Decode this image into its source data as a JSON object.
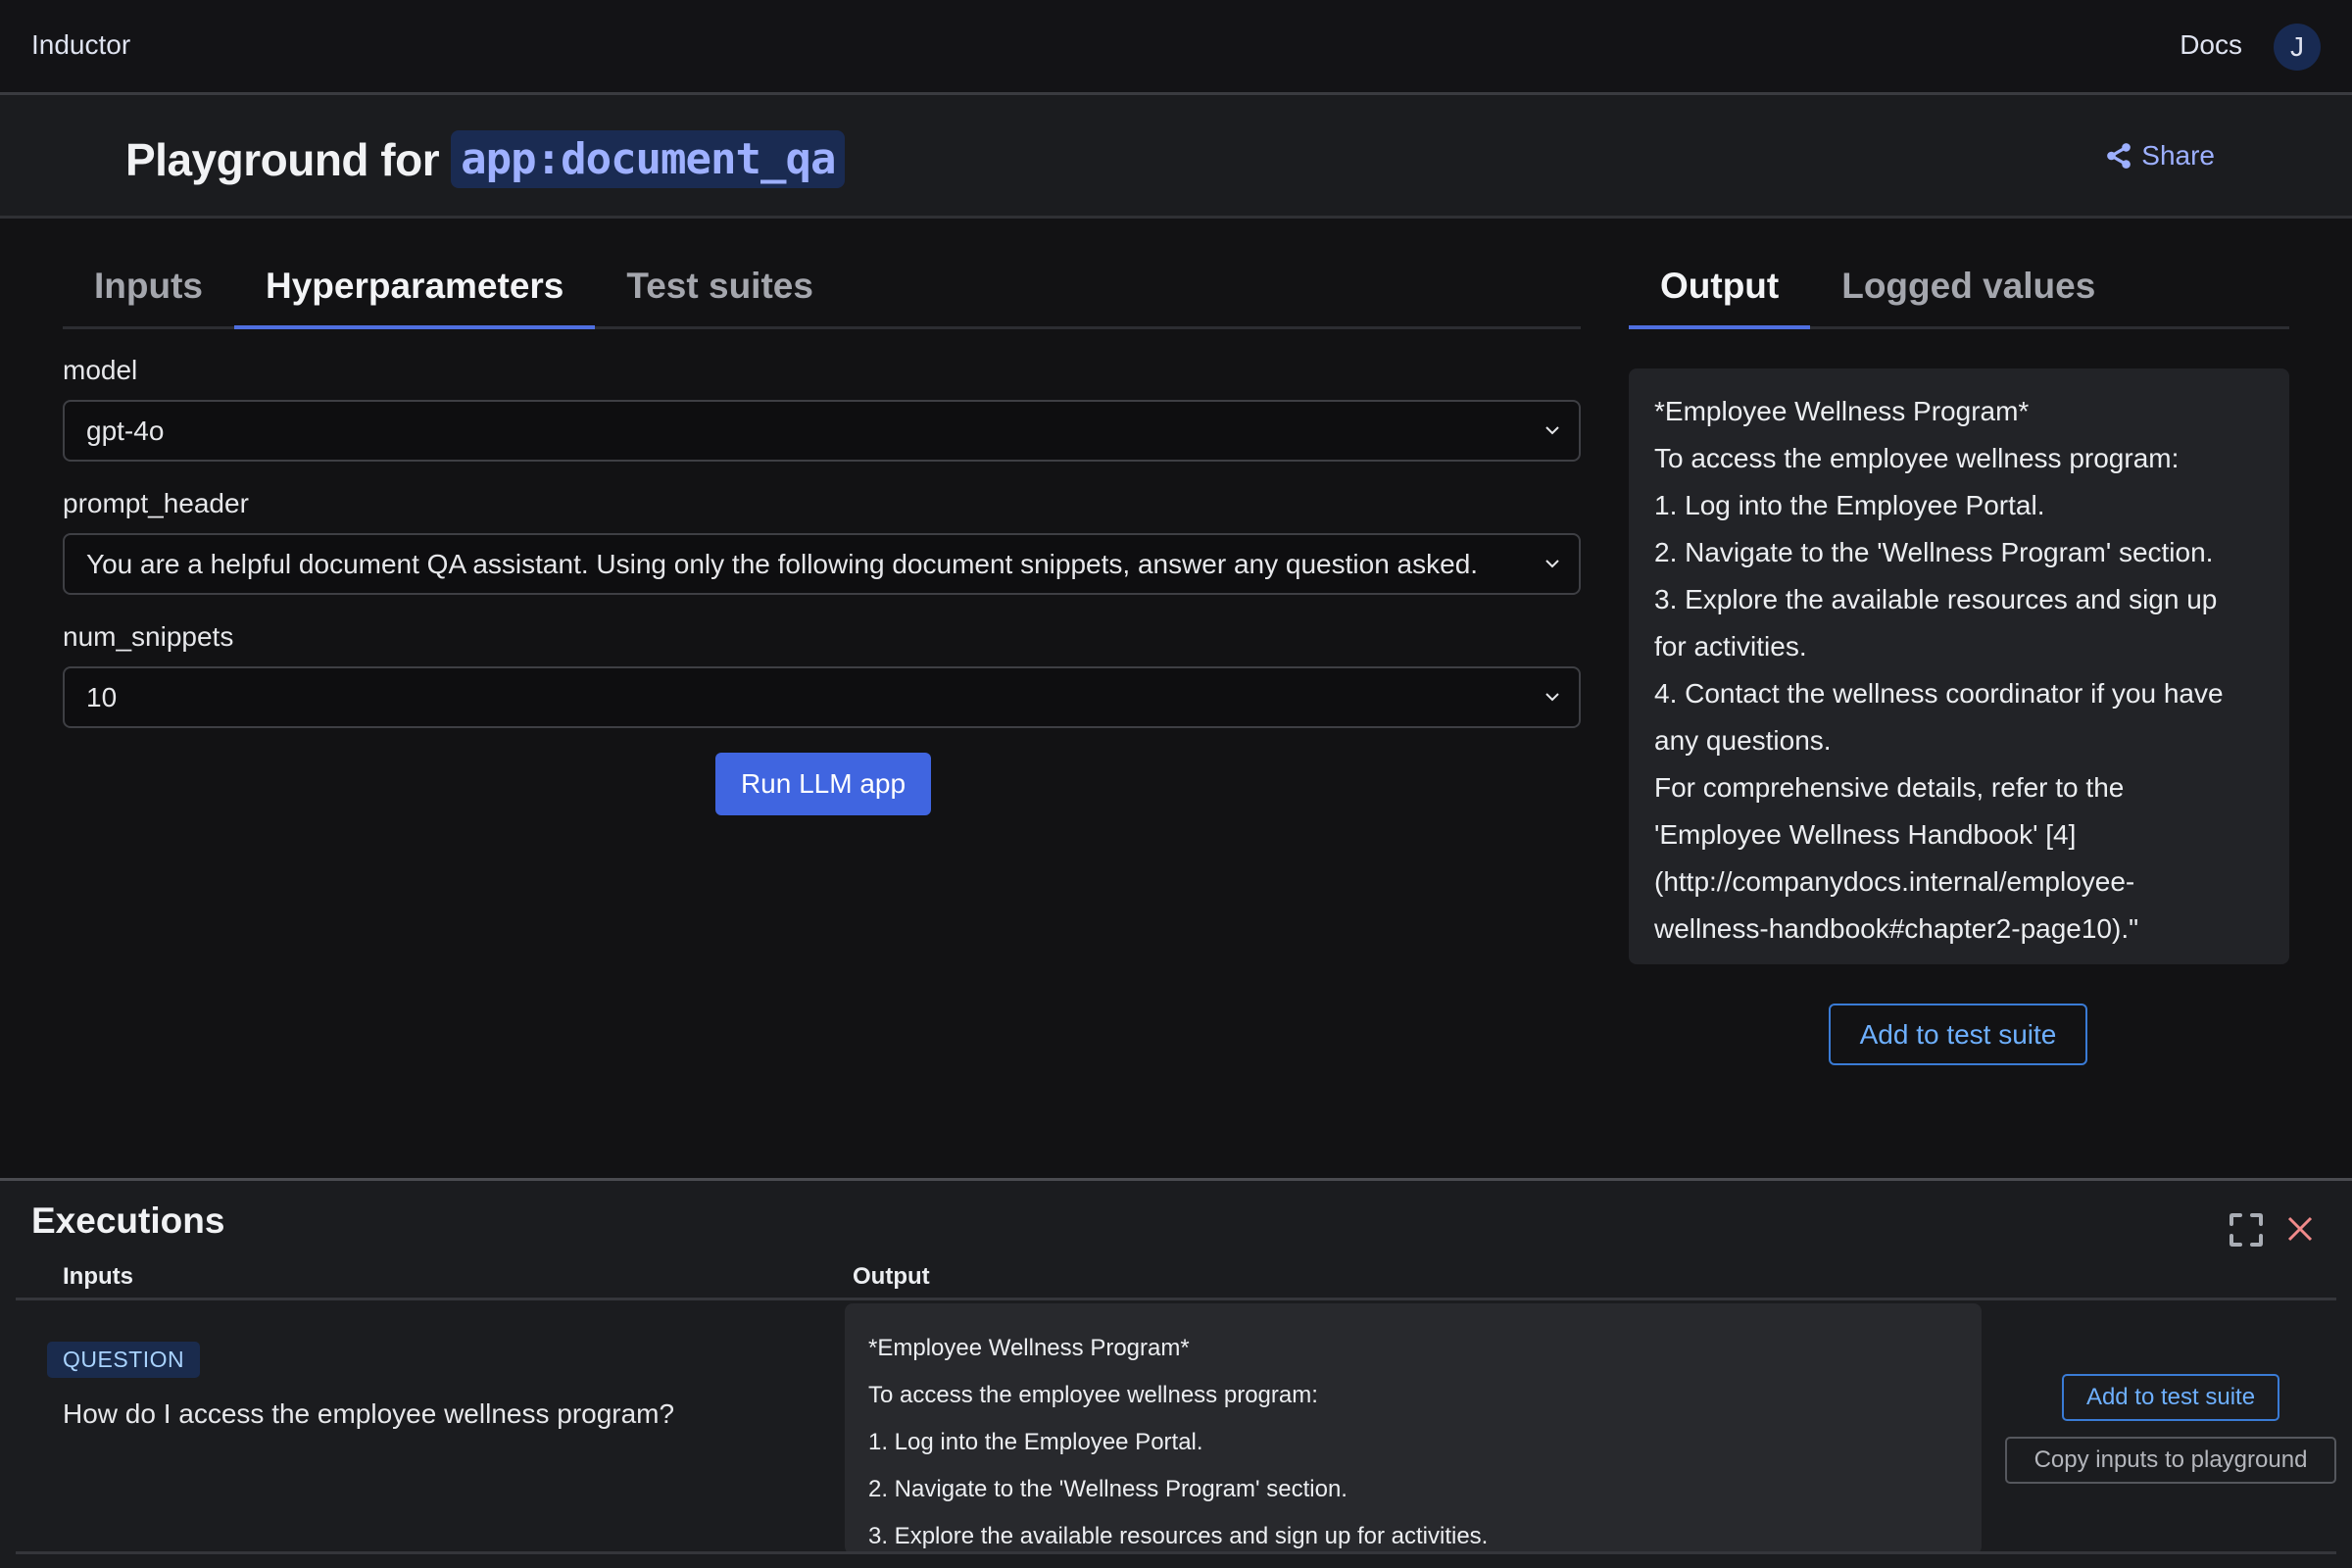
{
  "topbar": {
    "brand": "Inductor",
    "docs_label": "Docs",
    "avatar_initial": "J"
  },
  "header": {
    "title_prefix": "Playground for",
    "app_name": "app:document_qa",
    "share_label": "Share",
    "share_icon": "share-icon"
  },
  "left_panel": {
    "tabs": [
      {
        "label": "Inputs",
        "active": false
      },
      {
        "label": "Hyperparameters",
        "active": true
      },
      {
        "label": "Test suites",
        "active": false
      }
    ],
    "fields": [
      {
        "label": "model",
        "value": "gpt-4o"
      },
      {
        "label": "prompt_header",
        "value": "You are a helpful document QA assistant. Using only the following document snippets, answer any question asked."
      },
      {
        "label": "num_snippets",
        "value": "10"
      }
    ],
    "run_button": "Run LLM app"
  },
  "right_panel": {
    "tabs": [
      {
        "label": "Output",
        "active": true
      },
      {
        "label": "Logged values",
        "active": false
      }
    ],
    "output_lines": [
      "*Employee Wellness Program*",
      "To access the employee wellness program:",
      "1. Log into the Employee Portal.",
      "2. Navigate to the 'Wellness Program' section.",
      "3. Explore the available resources and sign up",
      "for activities.",
      "4. Contact the wellness coordinator if you have",
      "any questions.",
      "For comprehensive details, refer to the",
      "'Employee Wellness Handbook' [4]",
      "(http://companydocs.internal/employee-",
      "wellness-handbook#chapter2-page10).\""
    ],
    "add_button": "Add to test suite"
  },
  "executions": {
    "title": "Executions",
    "columns": [
      "Inputs",
      "Output"
    ],
    "rows": [
      {
        "input_badge": "QUESTION",
        "input_value": "How do I access the employee wellness program?",
        "output_lines": [
          "*Employee Wellness Program*",
          "To access the employee wellness program:",
          "1. Log into the Employee Portal.",
          "2. Navigate to the 'Wellness Program' section.",
          "3. Explore the available resources and sign up for activities."
        ],
        "add_button": "Add to test suite",
        "copy_button": "Copy inputs to playground"
      }
    ]
  },
  "colors": {
    "accent": "#4065e0",
    "link": "#6eb0ff",
    "close": "#f08a8a"
  }
}
